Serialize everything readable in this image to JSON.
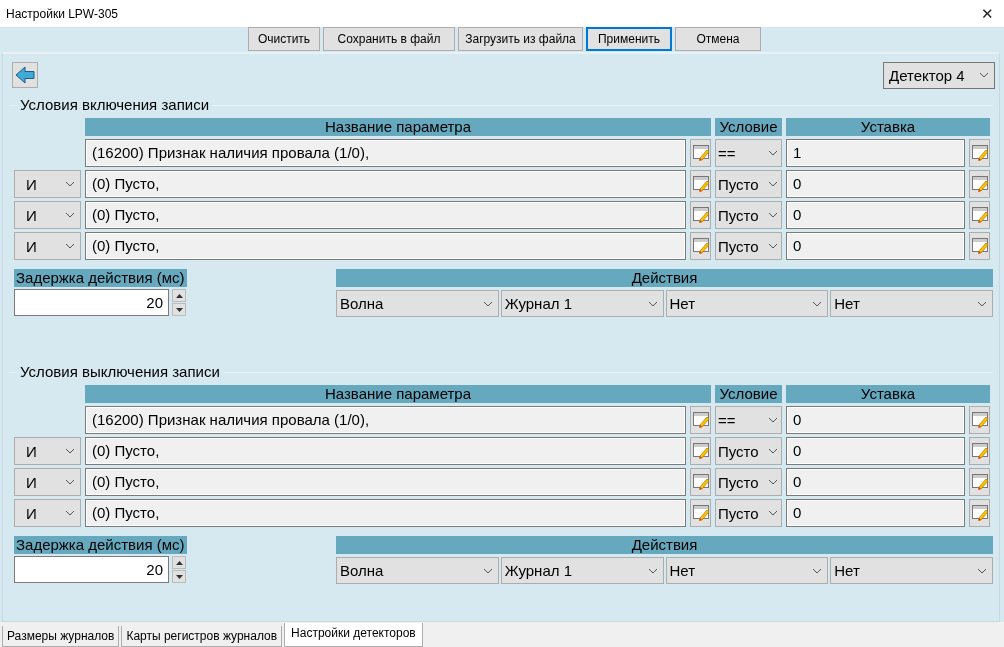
{
  "window": {
    "title": "Настройки LPW-305",
    "close": "✕"
  },
  "toolbar": [
    {
      "label": "Очистить",
      "selected": false
    },
    {
      "label": "Сохранить в файл",
      "selected": false
    },
    {
      "label": "Загрузить из файла",
      "selected": false
    },
    {
      "label": "Применить",
      "selected": true
    },
    {
      "label": "Отмена",
      "selected": false
    }
  ],
  "detector": {
    "value": "Детектор 4"
  },
  "sections": [
    {
      "title": "Условия включения записи",
      "columns": [
        "Название параметра",
        "Условие",
        "Уставка"
      ],
      "rows": [
        {
          "logic": null,
          "parameter": "(16200) Признак наличия провала (1/0),",
          "condition": "==",
          "setpoint": "1"
        },
        {
          "logic": "И",
          "parameter": "(0) Пусто,",
          "condition": "Пусто",
          "setpoint": "0"
        },
        {
          "logic": "И",
          "parameter": "(0) Пусто,",
          "condition": "Пусто",
          "setpoint": "0"
        },
        {
          "logic": "И",
          "parameter": "(0) Пусто,",
          "condition": "Пусто",
          "setpoint": "0"
        }
      ],
      "delay": {
        "label": "Задержка действия (мс)",
        "value": "20"
      },
      "actions": {
        "label": "Действия",
        "values": [
          "Волна",
          "Журнал 1",
          "Нет",
          "Нет"
        ]
      }
    },
    {
      "title": "Условия выключения записи",
      "columns": [
        "Название параметра",
        "Условие",
        "Уставка"
      ],
      "rows": [
        {
          "logic": null,
          "parameter": "(16200) Признак наличия провала (1/0),",
          "condition": "==",
          "setpoint": "0"
        },
        {
          "logic": "И",
          "parameter": "(0) Пусто,",
          "condition": "Пусто",
          "setpoint": "0"
        },
        {
          "logic": "И",
          "parameter": "(0) Пусто,",
          "condition": "Пусто",
          "setpoint": "0"
        },
        {
          "logic": "И",
          "parameter": "(0) Пусто,",
          "condition": "Пусто",
          "setpoint": "0"
        }
      ],
      "delay": {
        "label": "Задержка действия (мс)",
        "value": "20"
      },
      "actions": {
        "label": "Действия",
        "values": [
          "Волна",
          "Журнал 1",
          "Нет",
          "Нет"
        ]
      }
    }
  ],
  "tabs": [
    {
      "label": "Размеры журналов",
      "selected": false
    },
    {
      "label": "Карты регистров журналов",
      "selected": false
    },
    {
      "label": "Настройки детекторов",
      "selected": true
    }
  ]
}
